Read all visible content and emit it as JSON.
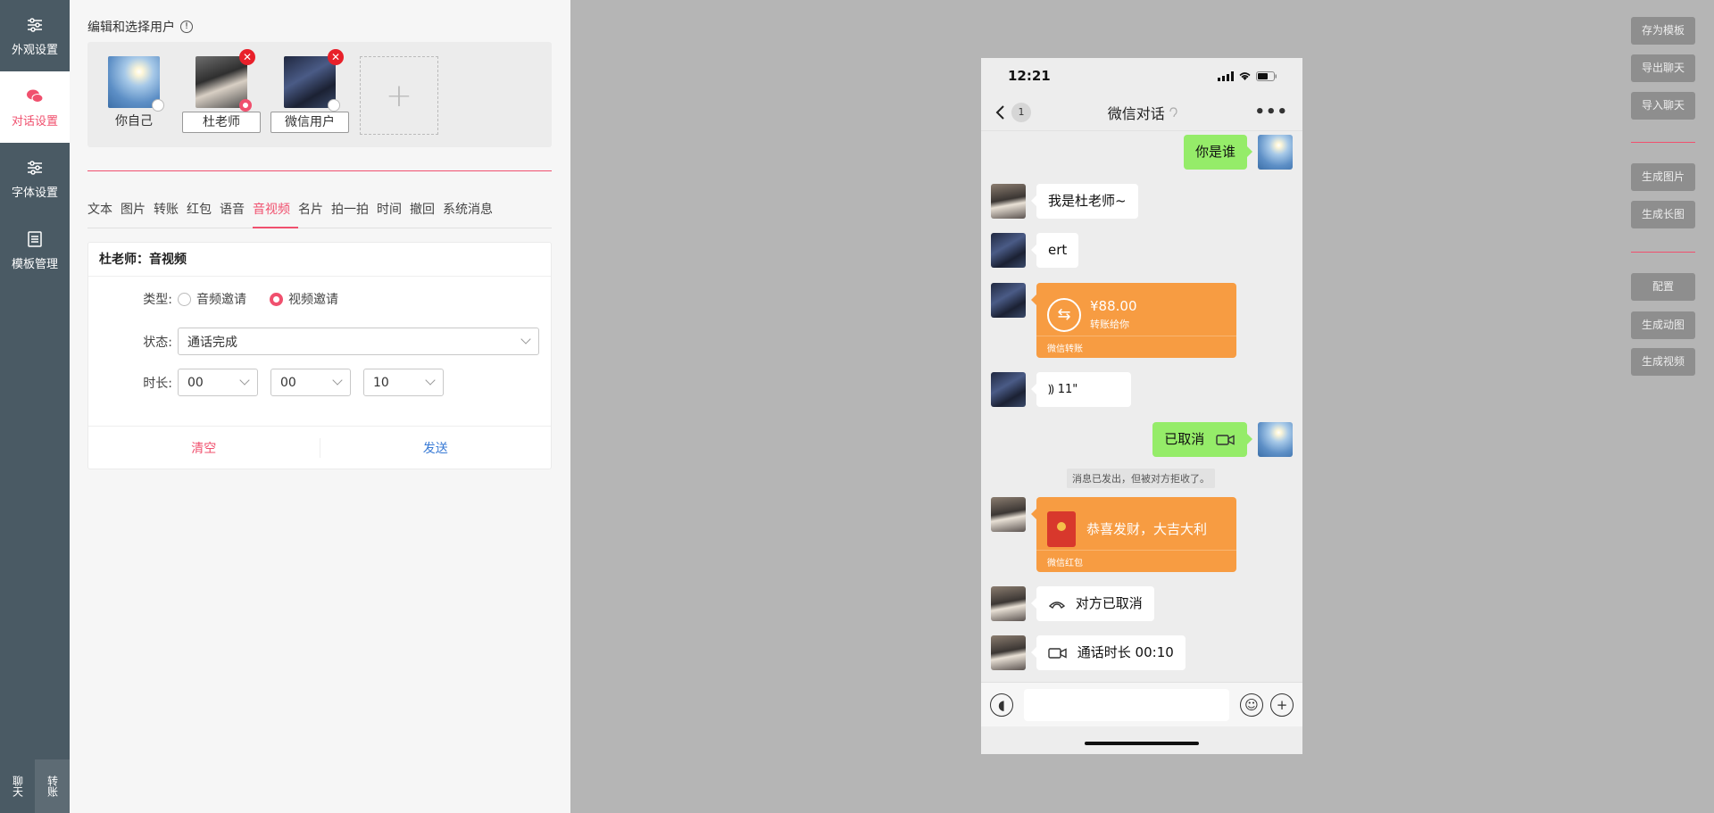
{
  "nav": {
    "items": [
      {
        "label": "外观设置"
      },
      {
        "label": "对话设置"
      },
      {
        "label": "字体设置"
      },
      {
        "label": "模板管理"
      }
    ],
    "bottom": {
      "chat": "聊天",
      "transfer": "转账"
    }
  },
  "editor": {
    "section_title": "编辑和选择用户",
    "users": [
      {
        "name": "你自己"
      },
      {
        "name": "杜老师"
      },
      {
        "name": "微信用户"
      }
    ],
    "add_label": "+",
    "tabs": [
      "文本",
      "图片",
      "转账",
      "红包",
      "语音",
      "音视频",
      "名片",
      "拍一拍",
      "时间",
      "撤回",
      "系统消息"
    ],
    "active_tab": "音视频",
    "form": {
      "title": "杜老师：音视频",
      "type_label": "类型:",
      "type_options": [
        "音频邀请",
        "视频邀请"
      ],
      "type_selected": "视频邀请",
      "status_label": "状态:",
      "status_value": "通话完成",
      "duration_label": "时长:",
      "duration": [
        "00",
        "00",
        "10"
      ],
      "clear": "清空",
      "send": "发送"
    }
  },
  "phone": {
    "time": "12:21",
    "unread": "1",
    "title": "微信对话",
    "more": "•••",
    "messages": {
      "m1": "你是谁",
      "m2": "我是杜老师~",
      "m3": "ert",
      "transfer_amount": "¥88.00",
      "transfer_note": "转账给你",
      "transfer_foot": "微信转账",
      "voice": "11\"",
      "cancelled": "已取消",
      "system": "消息已发出，但被对方拒收了。",
      "redpacket": "恭喜发财，大吉大利",
      "redpacket_foot": "微信红包",
      "peer_cancel": "对方已取消",
      "call_duration": "通话时长 00:10"
    }
  },
  "right_buttons": {
    "save_template": "存为模板",
    "export_chat": "导出聊天",
    "import_chat": "导入聊天",
    "gen_image": "生成图片",
    "gen_long": "生成长图",
    "config": "配置",
    "gen_anim": "生成动图",
    "gen_video": "生成视频"
  },
  "colors": {
    "accent": "#f0506e",
    "nav_bg": "#4a5a64",
    "send_blue": "#3a7bd5",
    "bubble_green": "#95ec69",
    "bubble_orange": "#f79c42"
  }
}
